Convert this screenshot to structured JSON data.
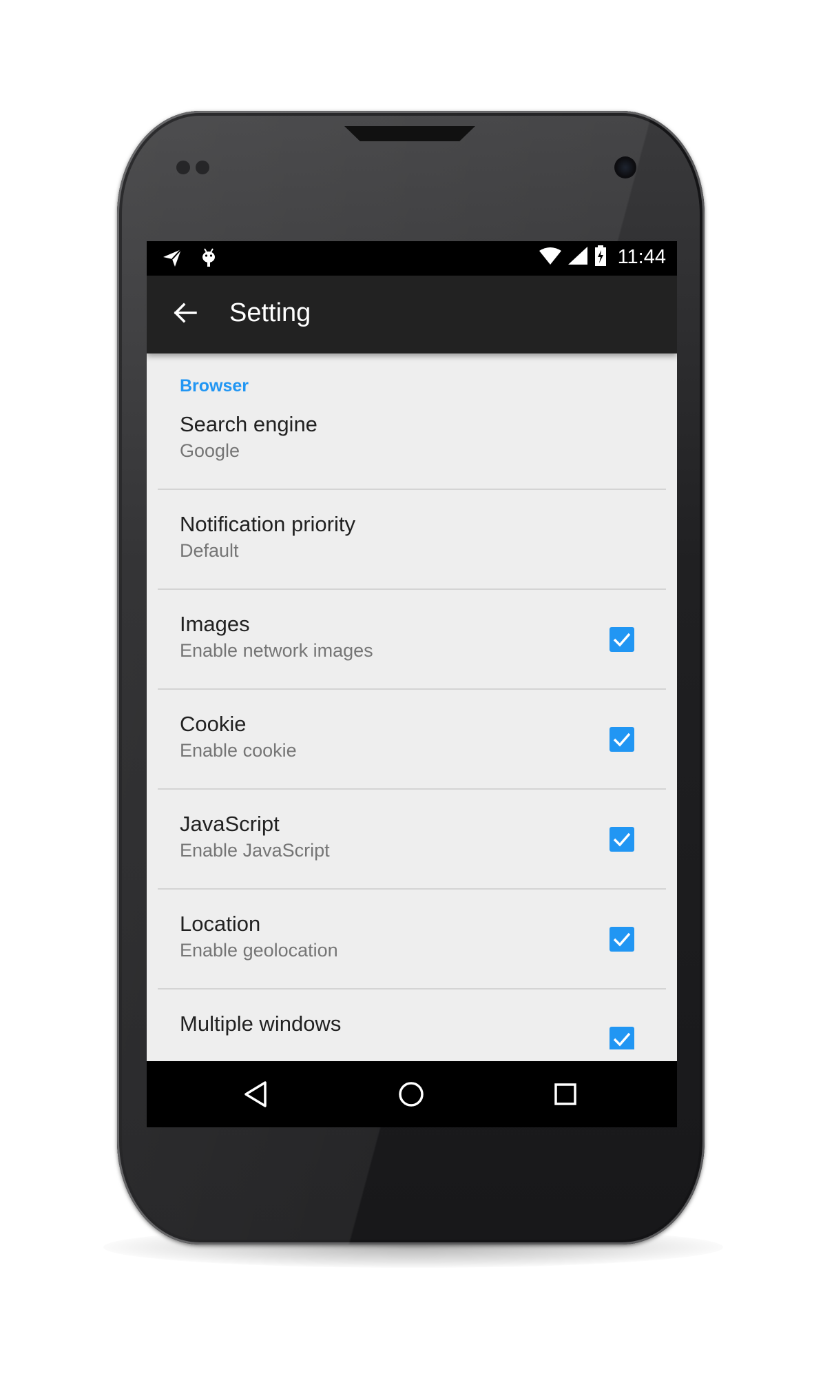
{
  "status_bar": {
    "left_icons": [
      "send-icon",
      "android-debug-icon"
    ],
    "right_icons": [
      "wifi-icon",
      "cell-signal-icon",
      "battery-charging-icon"
    ],
    "time": "11:44"
  },
  "app_bar": {
    "back_icon": "arrow-back-icon",
    "title": "Setting"
  },
  "settings": {
    "section_header": "Browser",
    "items": [
      {
        "title": "Search engine",
        "summary": "Google",
        "has_checkbox": false
      },
      {
        "title": "Notification priority",
        "summary": "Default",
        "has_checkbox": false
      },
      {
        "title": "Images",
        "summary": "Enable network images",
        "has_checkbox": true,
        "checked": true
      },
      {
        "title": "Cookie",
        "summary": "Enable cookie",
        "has_checkbox": true,
        "checked": true
      },
      {
        "title": "JavaScript",
        "summary": "Enable JavaScript",
        "has_checkbox": true,
        "checked": true
      },
      {
        "title": "Location",
        "summary": "Enable geolocation",
        "has_checkbox": true,
        "checked": true
      },
      {
        "title": "Multiple windows",
        "summary": "",
        "has_checkbox": true,
        "checked": true
      }
    ]
  },
  "nav_bar": {
    "buttons": [
      "back-triangle-icon",
      "home-circle-icon",
      "recents-square-icon"
    ]
  },
  "colors": {
    "accent": "#2196f3",
    "app_bar": "#222222",
    "status_bar": "#000000",
    "background": "#eeeeee"
  }
}
